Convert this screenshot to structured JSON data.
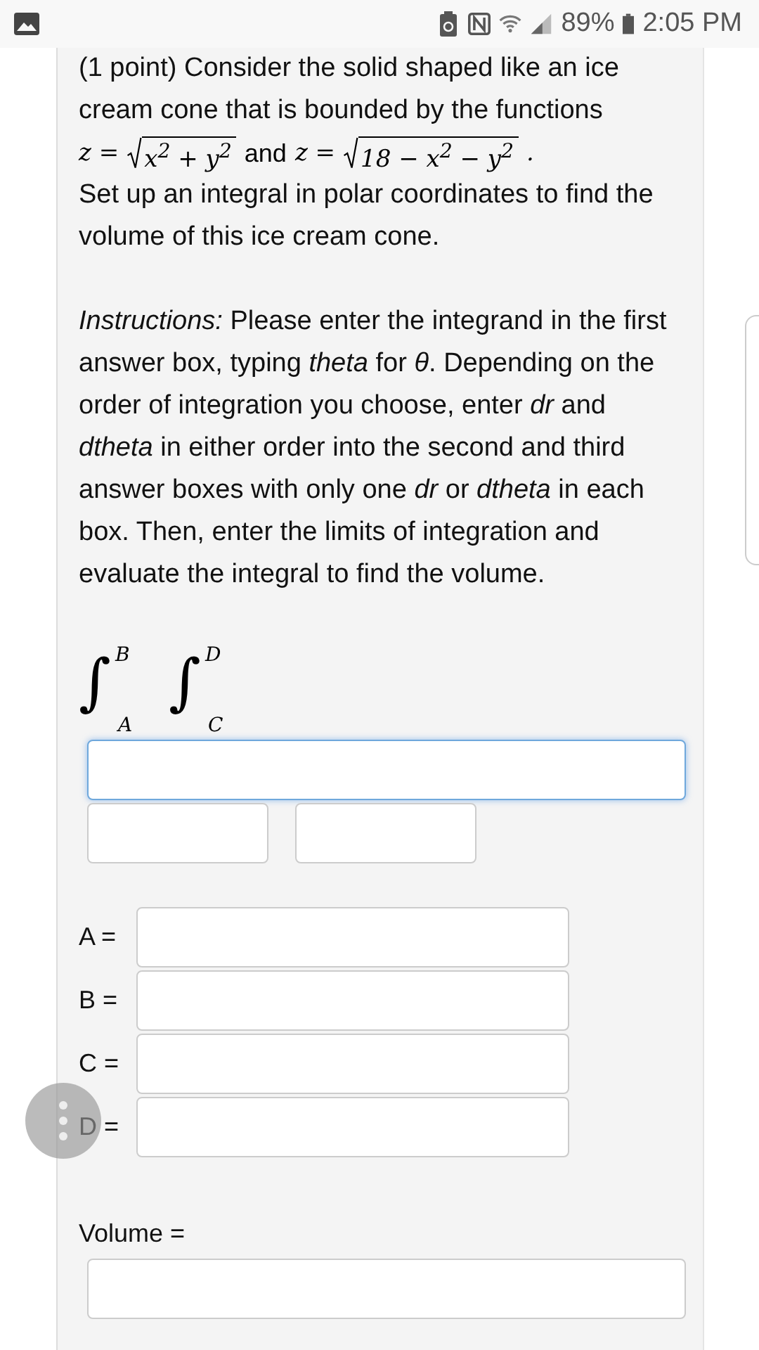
{
  "status_bar": {
    "battery_percent": "89%",
    "time": "2:05 PM"
  },
  "problem": {
    "intro": "(1 point) Consider the solid shaped like an ice cream cone that is bounded by the functions",
    "formulas": [
      {
        "lhs": "z =",
        "radicand": "x$^{2}$ + y$^{2}$",
        "after": "and"
      },
      {
        "lhs": "z =",
        "radicand": "18 − x$^{2}$ − y$^{2}$",
        "after": "."
      }
    ],
    "task": "Set up an integral in polar coordinates to find the volume of this ice cream cone.",
    "instructions": "*Instructions:* Please enter the integrand in the first answer box, typing *theta* for *θ*. Depending on the order of integration you choose, enter *dr* and *dtheta* in either order into the second and third answer boxes with only one *dr* or *dtheta* in each box. Then, enter the limits of integration and evaluate the integral to find the volume."
  },
  "integral": {
    "signs": [
      {
        "symbol": "∫",
        "upper": "B",
        "lower": "A"
      },
      {
        "symbol": "∫",
        "upper": "D",
        "lower": "C"
      }
    ],
    "integrand_field": {
      "focused": true
    },
    "differential_fields": [
      {
        "focused": false
      },
      {
        "focused": false
      }
    ]
  },
  "limits": [
    {
      "label": "A =",
      "focused": false
    },
    {
      "label": "B =",
      "focused": false
    },
    {
      "label": "C =",
      "focused": false
    },
    {
      "label": "D =",
      "focused": false
    }
  ],
  "volume": {
    "label": "Volume =",
    "focused": false
  }
}
